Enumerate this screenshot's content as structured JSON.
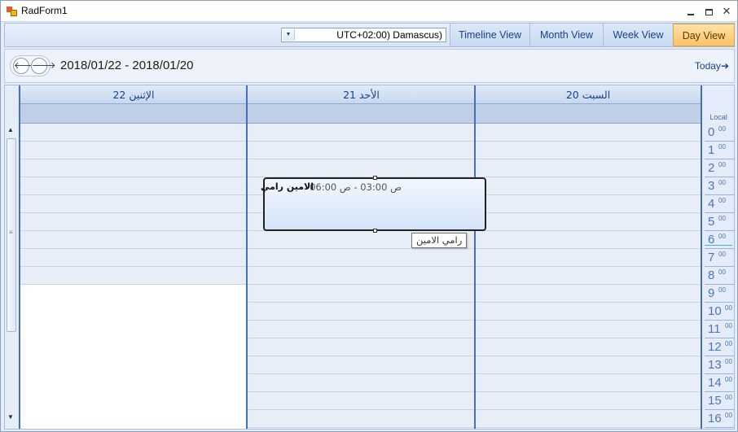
{
  "window": {
    "title": "RadForm1"
  },
  "toolbar": {
    "timezone_value": "UTC+02:00) Damascus)",
    "views": [
      "Timeline View",
      "Month View",
      "Week View",
      "Day View"
    ],
    "active_view": "Day View"
  },
  "navigator": {
    "date_range": "2018/01/22 - 2018/01/20",
    "today_label": "Today"
  },
  "columns": [
    "22 الإثنين",
    "21 الأحد",
    "20 السبت"
  ],
  "appointment": {
    "time": "ص 03:00 - ص 06:00",
    "subject": "الامين رامي",
    "tooltip": "رامي الامين"
  },
  "ruler": {
    "label": "Local",
    "hours": [
      "0",
      "1",
      "2",
      "3",
      "4",
      "5",
      "6",
      "7",
      "8",
      "9",
      "10",
      "11",
      "12",
      "13",
      "14",
      "15",
      "16"
    ],
    "minutes": "00"
  }
}
